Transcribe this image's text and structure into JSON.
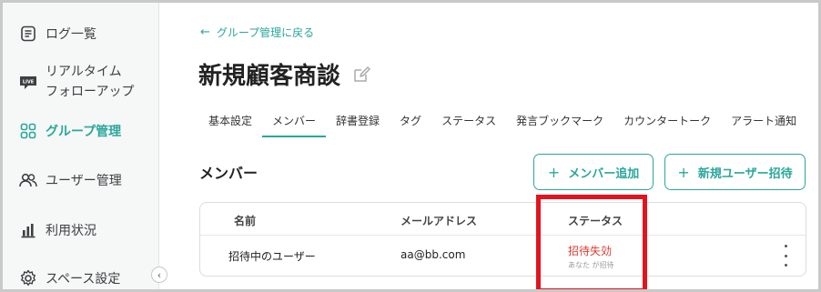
{
  "sidebar": {
    "items": [
      {
        "label": "ログ一覧",
        "icon": "log-list-icon"
      },
      {
        "label_line1": "リアルタイム",
        "label_line2": "フォローアップ",
        "icon": "live-icon",
        "badge": "LIVE"
      },
      {
        "label": "グループ管理",
        "icon": "group-grid-icon",
        "active": true
      },
      {
        "label": "ユーザー管理",
        "icon": "users-icon"
      },
      {
        "label": "利用状況",
        "icon": "bar-chart-icon"
      },
      {
        "label": "スペース設定",
        "icon": "gear-icon"
      }
    ],
    "collapse_glyph": "‹"
  },
  "main": {
    "back_link": "グループ管理に戻る",
    "back_arrow": "←",
    "title": "新規顧客商談",
    "tabs": [
      "基本設定",
      "メンバー",
      "辞書登録",
      "タグ",
      "ステータス",
      "発言ブックマーク",
      "カウンタートーク",
      "アラート通知"
    ],
    "active_tab": "メンバー",
    "section_title": "メンバー",
    "buttons": {
      "add_member": "メンバー追加",
      "invite_user": "新規ユーザー招待",
      "plus": "+"
    },
    "table": {
      "headers": [
        "名前",
        "メールアドレス",
        "ステータス"
      ],
      "rows": [
        {
          "name": "招待中のユーザー",
          "email": "aa@bb.com",
          "status": "招待失効",
          "status_sub": "あなた が招待"
        }
      ]
    }
  },
  "colors": {
    "accent": "#2aa79b",
    "error": "#e23b30",
    "highlight_box": "#e2141e",
    "sidebar_bg": "#f6f7f7"
  }
}
